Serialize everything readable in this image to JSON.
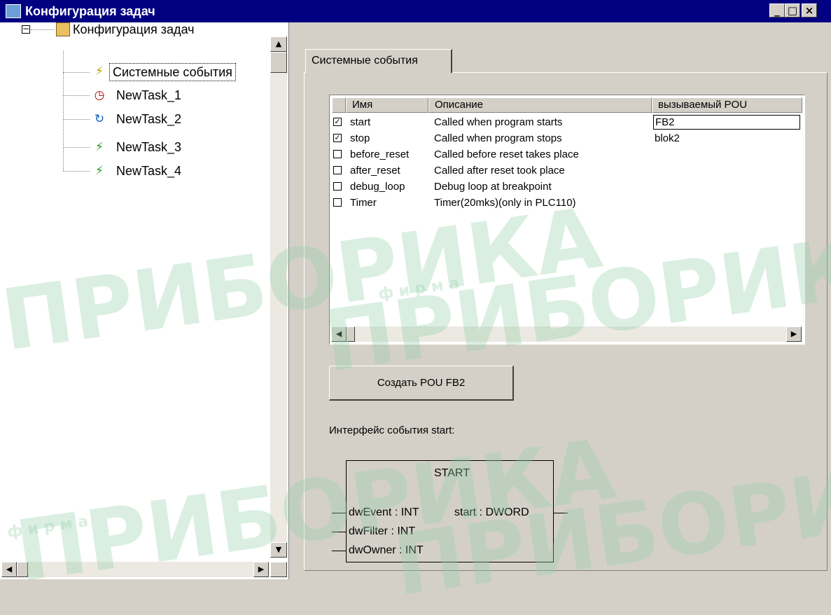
{
  "window": {
    "title": "Конфигурация задач",
    "minimize_glyph": "_",
    "maximize_glyph": "□",
    "close_glyph": "×"
  },
  "tree": {
    "collapse_glyph": "−",
    "root_icon": "config-folder-icon",
    "root_label": "Конфигурация задач",
    "items": [
      {
        "label": "Системные события",
        "icon": "lightning-icon",
        "selected": true
      },
      {
        "label": "NewTask_1",
        "icon": "clock-icon"
      },
      {
        "label": "NewTask_2",
        "icon": "cycle-arrows-icon"
      },
      {
        "label": "NewTask_3",
        "icon": "lightning-icon"
      },
      {
        "label": "NewTask_4",
        "icon": "lightning-icon"
      }
    ]
  },
  "tab": {
    "label": "Системные события"
  },
  "events_table": {
    "headers": [
      "Имя",
      "Описание",
      "вызываемый POU"
    ],
    "rows": [
      {
        "checked": true,
        "check_glyph": "✓",
        "name": "start",
        "description": "Called when program starts",
        "pou": "FB2"
      },
      {
        "checked": true,
        "check_glyph": "✓",
        "name": "stop",
        "description": "Called when program stops",
        "pou": "blok2"
      },
      {
        "checked": false,
        "check_glyph": "",
        "name": "before_reset",
        "description": "Called before reset takes place",
        "pou": ""
      },
      {
        "checked": false,
        "check_glyph": "",
        "name": "after_reset",
        "description": "Called after reset took place",
        "pou": ""
      },
      {
        "checked": false,
        "check_glyph": "",
        "name": "debug_loop",
        "description": "Debug loop at breakpoint",
        "pou": ""
      },
      {
        "checked": false,
        "check_glyph": "",
        "name": "Timer",
        "description": "Timer(20mks)(only in PLC110)",
        "pou": ""
      }
    ]
  },
  "create_button": {
    "label": "Создать POU FB2"
  },
  "interface": {
    "label": "Интерфейс события start:",
    "block_name": "START",
    "inputs": [
      "dwEvent : INT",
      "dwFilter : INT",
      "dwOwner : INT"
    ],
    "output": "start : DWORD"
  },
  "scroll_glyphs": {
    "up": "▲",
    "down": "▼",
    "left": "◀",
    "right": "▶"
  },
  "watermark": {
    "text": "ПРИБОРИКА",
    "caption": "ф и р м а"
  }
}
